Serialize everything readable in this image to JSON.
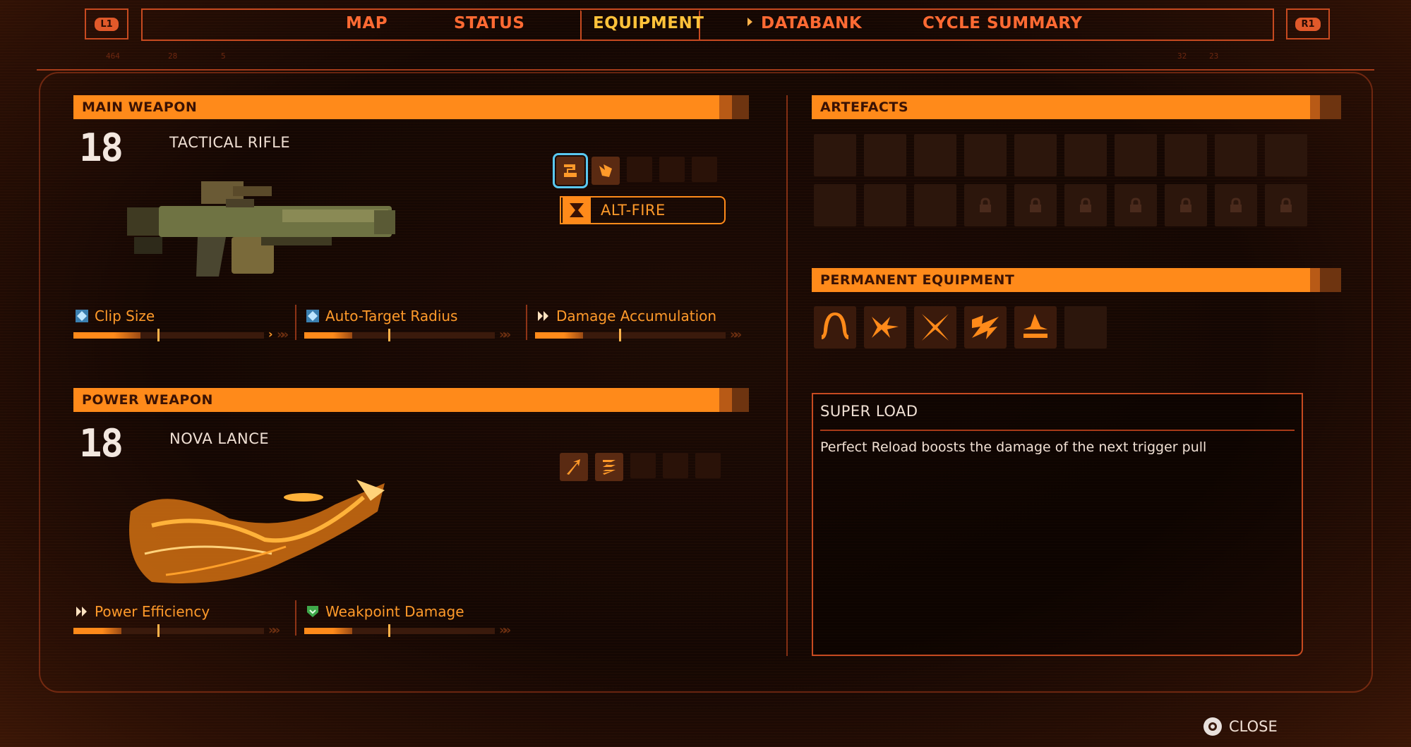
{
  "nav": {
    "left_shoulder": "L1",
    "right_shoulder": "R1",
    "tabs": [
      {
        "label": "MAP"
      },
      {
        "label": "STATUS"
      },
      {
        "label": "EQUIPMENT"
      },
      {
        "label": "DATABANK"
      },
      {
        "label": "CYCLE SUMMARY"
      }
    ],
    "active_tab": "EQUIPMENT"
  },
  "main_weapon": {
    "header": "MAIN WEAPON",
    "level": "18",
    "name": "TACTICAL RIFLE",
    "alt_fire_label": "ALT-FIRE",
    "mod_icons": [
      "rifle-mod-swirl-icon",
      "rifle-mod-burst-icon"
    ],
    "stats": [
      {
        "label": "Clip Size",
        "icon": "hex-blue-icon",
        "fill": 0.35
      },
      {
        "label": "Auto-Target Radius",
        "icon": "hex-blue-icon",
        "fill": 0.25
      },
      {
        "label": "Damage Accumulation",
        "icon": "double-chevron-icon",
        "fill": 0.25
      }
    ]
  },
  "power_weapon": {
    "header": "POWER WEAPON",
    "level": "18",
    "name": "NOVA LANCE",
    "mod_icons": [
      "lance-mod-arrow-icon",
      "lance-mod-wave-icon"
    ],
    "stats": [
      {
        "label": "Power Efficiency",
        "icon": "double-chevron-icon",
        "fill": 0.25
      },
      {
        "label": "Weakpoint Damage",
        "icon": "shield-green-icon",
        "fill": 0.25
      }
    ]
  },
  "artefacts": {
    "header": "ARTEFACTS",
    "slots_total": 20,
    "locked_slots": 7
  },
  "permanent_equipment": {
    "header": "PERMANENT EQUIPMENT",
    "items": [
      "grapple-arch-icon",
      "dash-arrows-icon",
      "blade-cross-icon",
      "scanner-wave-icon",
      "platform-jump-icon"
    ]
  },
  "details": {
    "title": "SUPER LOAD",
    "text": "Perfect Reload boosts the damage of the next trigger pull"
  },
  "footer": {
    "close_label": "CLOSE"
  },
  "hud_numbers": [
    "464",
    "28",
    "5",
    "32",
    "23"
  ],
  "colors": {
    "accent": "#ff8a1a",
    "active_tab": "#ffc23a",
    "tab": "#ff6a33",
    "frame": "#c74a20",
    "selection": "#5ac8f0"
  }
}
